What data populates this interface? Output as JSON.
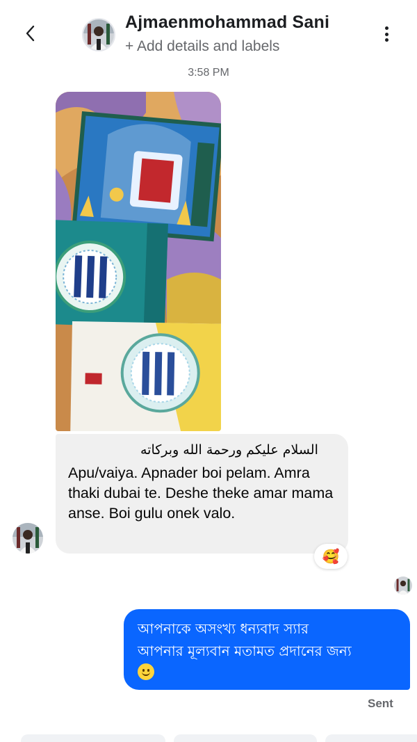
{
  "header": {
    "contact_name": "Ajmaenmohammad Sani",
    "add_details": "+ Add details and labels",
    "back_icon": "chevron-left-icon",
    "menu_icon": "more-vertical-icon"
  },
  "conversation": {
    "timestamp": "3:58 PM",
    "incoming": {
      "arabic_greeting": "السلام عليكم ورحمة الله وبركاته",
      "text": "Apu/vaiya. Apnader boi pelam. Amra thaki dubai te. Deshe theke amar mama anse. Boi gulu onek valo.",
      "reaction": "🥰"
    },
    "outgoing": {
      "line1": "আপনাকে অসংখ্য ধন্যবাদ স্যার",
      "line2": "আপনার মূল্যবান মতামত প্রদানের জন্য",
      "emoji_icon": "smiling-face-icon",
      "status": "Sent"
    }
  },
  "colors": {
    "outgoing_bubble": "#0a66ff",
    "incoming_bubble": "#f0f0f0",
    "secondary_text": "#65676b"
  }
}
